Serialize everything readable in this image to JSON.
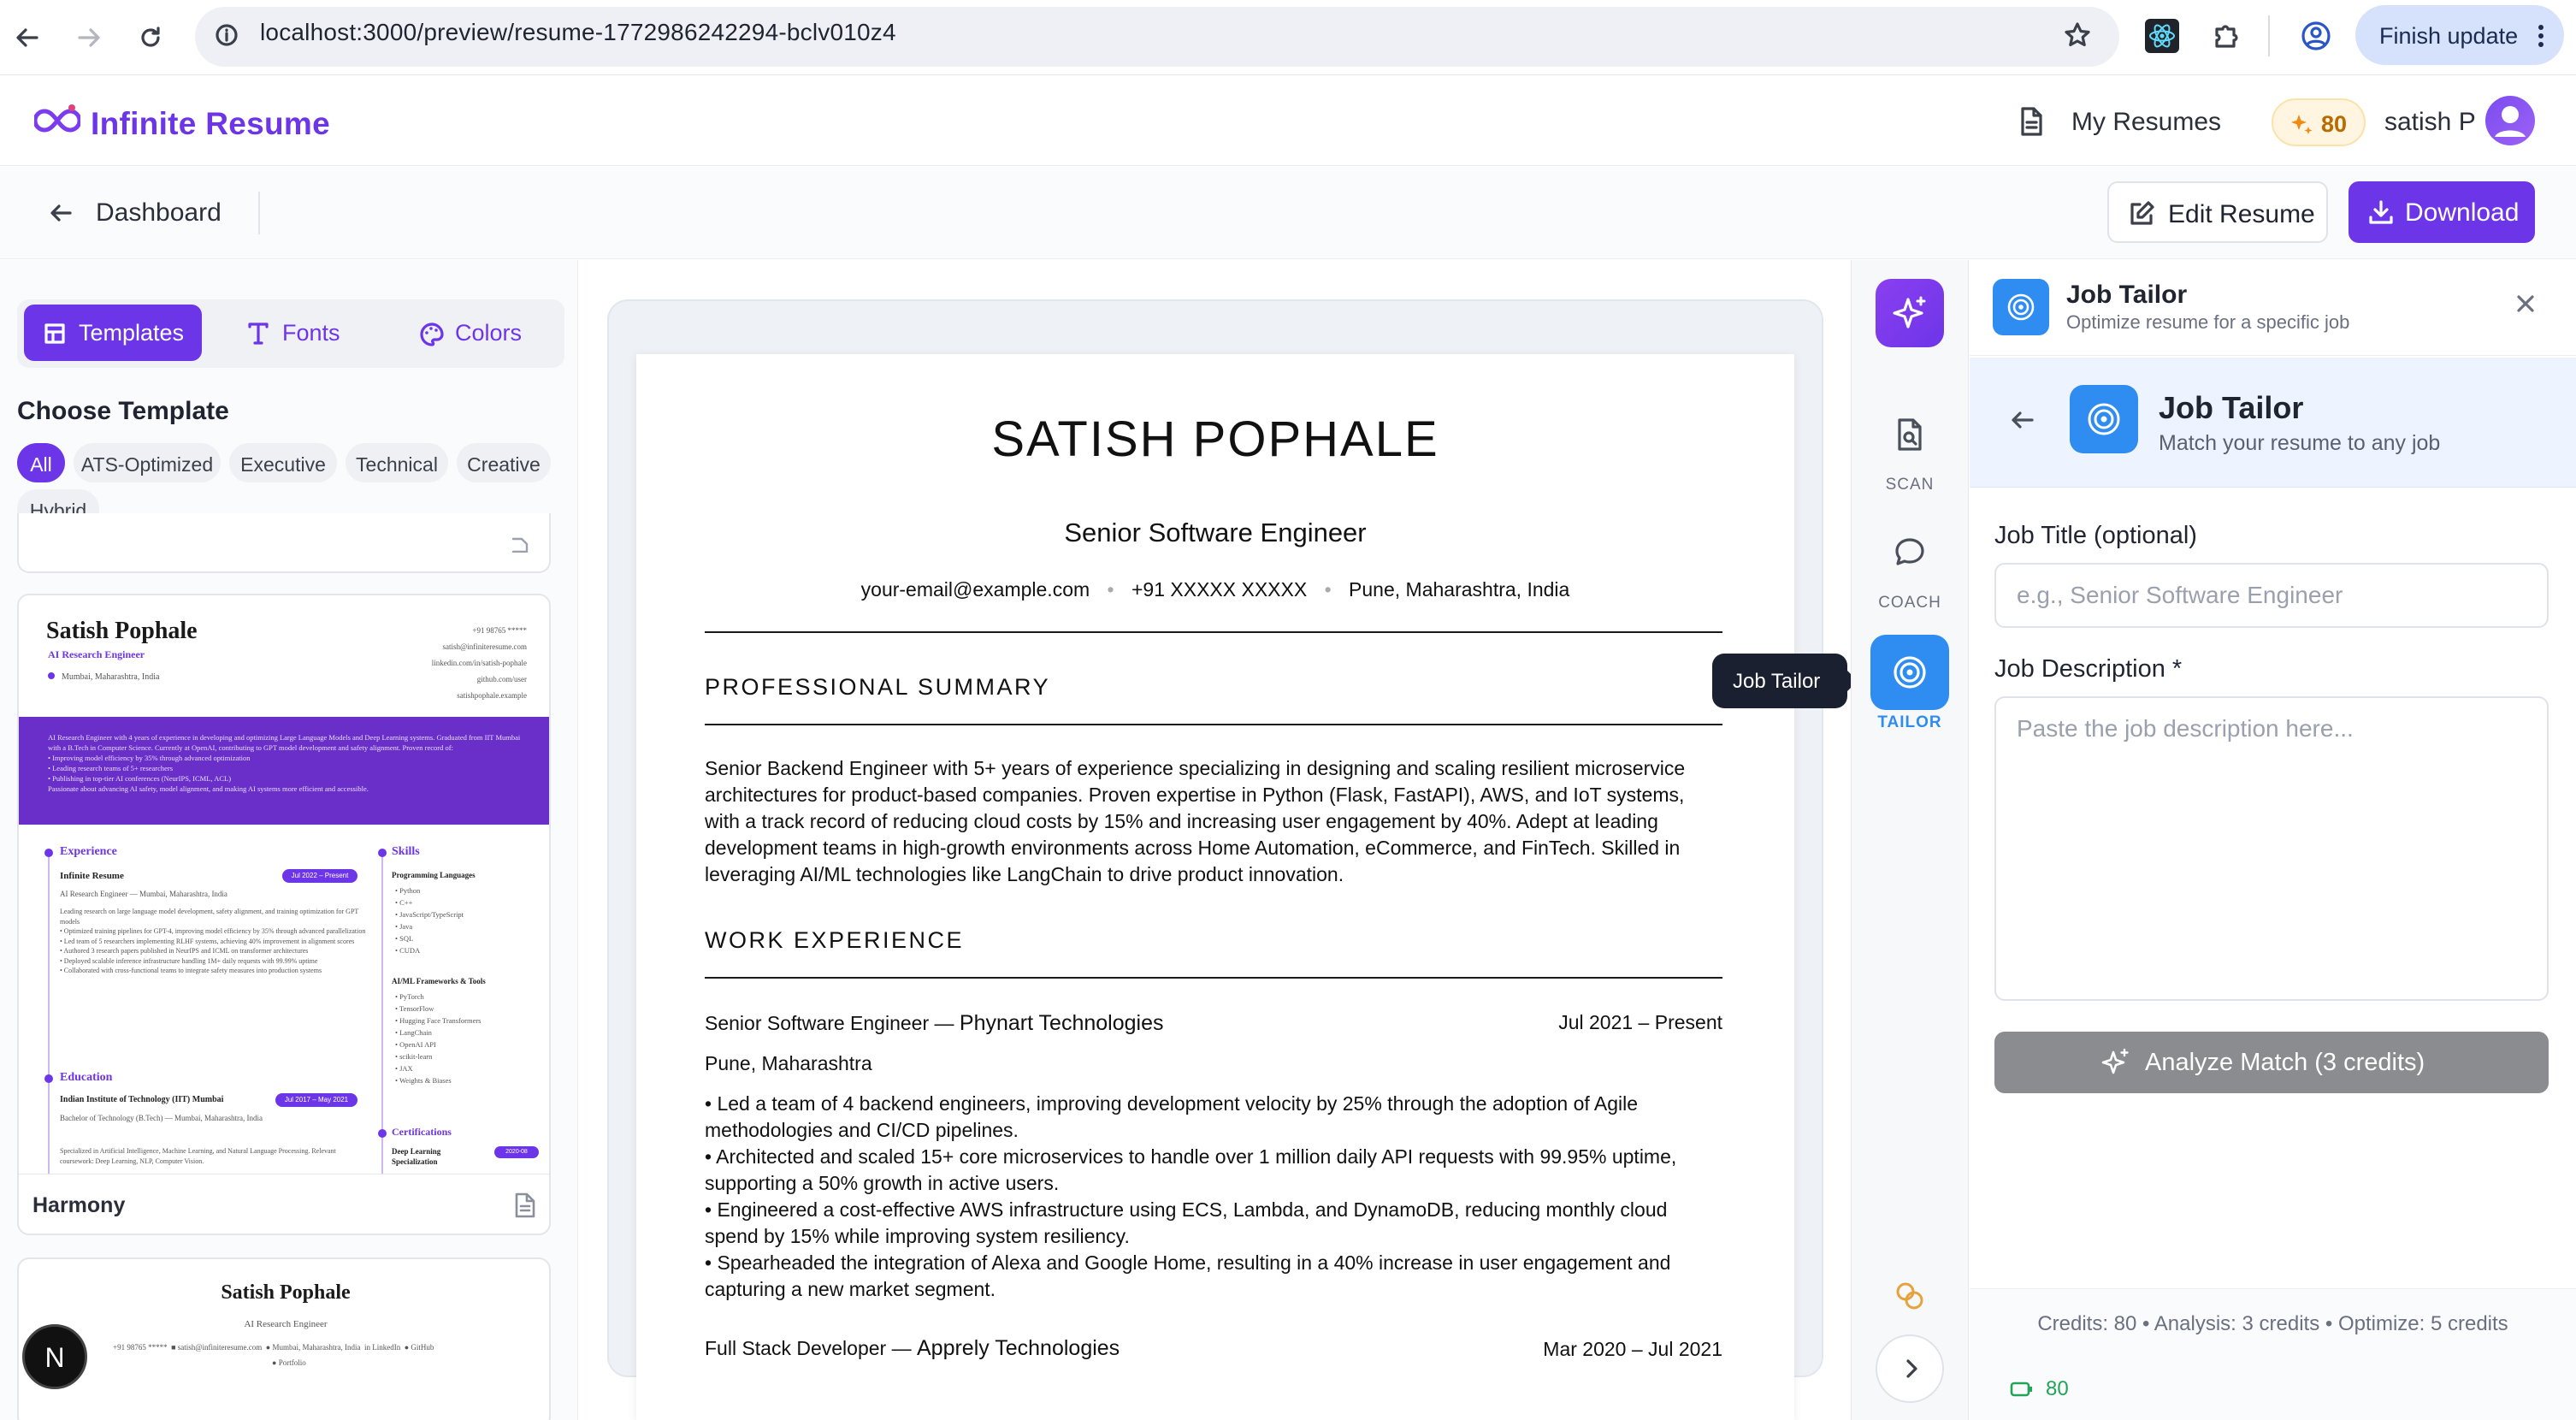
{
  "browser": {
    "url": "localhost:3000/preview/resume-1772986242294-bclv010z4",
    "finish_update_label": "Finish update"
  },
  "app": {
    "brand": "Infinite Resume",
    "my_resumes_label": "My Resumes",
    "credits": "80",
    "user_name": "satish P"
  },
  "toolbar": {
    "back_label": "Dashboard",
    "edit_label": "Edit Resume",
    "download_label": "Download"
  },
  "left_panel": {
    "tabs": [
      {
        "label": "Templates",
        "icon": "layout-icon"
      },
      {
        "label": "Fonts",
        "icon": "type-icon"
      },
      {
        "label": "Colors",
        "icon": "palette-icon"
      }
    ],
    "heading": "Choose Template",
    "filters": [
      "All",
      "ATS-Optimized",
      "Executive",
      "Technical",
      "Creative",
      "Hybrid"
    ],
    "cards": [
      {
        "name": "Harmony",
        "preview": {
          "name": "Satish Pophale",
          "role": "AI Research Engineer",
          "location": "Mumbai, Maharashtra, India",
          "contacts": [
            "+91 98765 *****",
            "satish@infiniteresume.com",
            "linkedin.com/in/satish-pophale",
            "github.com/user",
            "satishpophale.example"
          ],
          "summary": "AI Research Engineer with 4 years of experience in developing and optimizing Large Language Models and Deep Learning systems. Graduated from IIT Mumbai with a B.Tech in Computer Science. Currently at OpenAI, contributing to GPT model development and safety alignment. Proven record of:",
          "summary_points": [
            "• Improving model efficiency by 35% through advanced optimization",
            "• Leading research teams of 5+ researchers",
            "• Publishing in top-tier AI conferences (NeurIPS, ICML, ACL)",
            "Passionate about advancing AI safety, model alignment, and making AI systems more efficient and accessible."
          ],
          "experience_heading": "Experience",
          "company": "Infinite Resume",
          "job_dates": "Jul 2022 – Present",
          "job_role": "AI Research Engineer — Mumbai, Maharashtra, India",
          "job_points": [
            "Leading research on large language model development, safety alignment, and training optimization for GPT models",
            "• Optimized training pipelines for GPT-4, improving model efficiency by 35% through advanced parallelization",
            "• Led team of 5 researchers implementing RLHF systems, achieving 40% improvement in alignment scores",
            "• Authored 3 research papers published in NeurIPS and ICML on transformer architectures",
            "• Deployed scalable inference infrastructure handling 1M+ daily requests with 99.99% uptime",
            "• Collaborated with cross-functional teams to integrate safety measures into production systems"
          ],
          "education_heading": "Education",
          "school": "Indian Institute of Technology (IIT) Mumbai",
          "school_dates": "Jul 2017 – May 2021",
          "degree": "Bachelor of Technology (B.Tech) — Mumbai, Maharashtra, India",
          "edu_note": "Specialized in Artificial Intelligence, Machine Learning, and Natural Language Processing. Relevant coursework: Deep Learning, NLP, Computer Vision.",
          "skills_heading": "Skills",
          "skills_lang_heading": "Programming Languages",
          "skills_lang": [
            "• Python",
            "• C++",
            "• JavaScript/TypeScript",
            "• Java",
            "• SQL",
            "• CUDA"
          ],
          "skills_fw_heading": "AI/ML Frameworks & Tools",
          "skills_fw": [
            "• PyTorch",
            "• TensorFlow",
            "• Hugging Face Transformers",
            "• LangChain",
            "• OpenAI API",
            "• scikit-learn",
            "• JAX",
            "• Weights & Biases"
          ],
          "cert_heading": "Certifications",
          "cert_name": "Deep Learning Specialization",
          "cert_date": "2020-08"
        }
      },
      {
        "name": "",
        "preview": {
          "name": "Satish Pophale",
          "role": "AI Research Engineer",
          "contacts": [
            "+91 98765 *****",
            "satish@infiniteresume.com",
            "Mumbai, Maharashtra, India",
            "LinkedIn",
            "GitHub",
            "Portfolio"
          ]
        }
      }
    ]
  },
  "resume": {
    "name": "SATISH POPHALE",
    "title": "Senior Software Engineer",
    "email": "your-email@example.com",
    "phone": "+91 XXXXX XXXXX",
    "location": "Pune, Maharashtra, India",
    "summary_heading": "PROFESSIONAL SUMMARY",
    "summary": "Senior Backend Engineer with 5+ years of experience specializing in designing and scaling resilient microservice architectures for product-based companies. Proven expertise in Python (Flask, FastAPI), AWS, and IoT systems, with a track record of reducing cloud costs by 15% and increasing user engagement by 40%. Adept at leading development teams in high-growth environments across Home Automation, eCommerce, and FinTech. Skilled in leveraging AI/ML technologies like LangChain to drive product innovation.",
    "experience_heading": "WORK EXPERIENCE",
    "jobs": [
      {
        "role": "Senior Software Engineer — ",
        "company": "Phynart Technologies",
        "dates": "Jul 2021 – Present",
        "location": "Pune, Maharashtra",
        "bullets": [
          "• Led a team of 4 backend engineers, improving development velocity by 25% through the adoption of Agile methodologies and CI/CD pipelines.",
          "• Architected and scaled 15+ core microservices to handle over 1 million daily API requests with 99.95% uptime, supporting a 50% growth in active users.",
          "• Engineered a cost-effective AWS infrastructure using ECS, Lambda, and DynamoDB, reducing monthly cloud spend by 15% while improving system resiliency.",
          "• Spearheaded the integration of Alexa and Google Home, resulting in a 40% increase in user engagement and capturing a new market segment."
        ]
      },
      {
        "role": "Full Stack Developer — ",
        "company": "Apprely Technologies",
        "dates": "Mar 2020 – Jul 2021"
      }
    ]
  },
  "rail": {
    "tooltip": "Job Tailor",
    "items": [
      {
        "label": "SCAN",
        "icon": "scan-icon"
      },
      {
        "label": "COACH",
        "icon": "chat-icon"
      },
      {
        "label": "TAILOR",
        "icon": "target-icon"
      }
    ]
  },
  "tailor_panel": {
    "header_title": "Job Tailor",
    "header_subtitle": "Optimize resume for a specific job",
    "section_title": "Job Tailor",
    "section_subtitle": "Match your resume to any job",
    "job_title_label": "Job Title (optional)",
    "job_title_placeholder": "e.g., Senior Software Engineer",
    "job_title_value": "",
    "job_desc_label": "Job Description *",
    "job_desc_placeholder": "Paste the job description here...",
    "job_desc_value": "",
    "analyze_label": "Analyze Match (3 credits)",
    "footer_note": "Credits: 80 • Analysis: 3 credits • Optimize: 5 credits",
    "footer_credits": "80"
  },
  "dev_badge": "N",
  "colors": {
    "accent": "#6d35e8",
    "tailor_blue": "#2f8cf0",
    "credit_amber": "#b76b00",
    "success_green": "#22a456"
  }
}
